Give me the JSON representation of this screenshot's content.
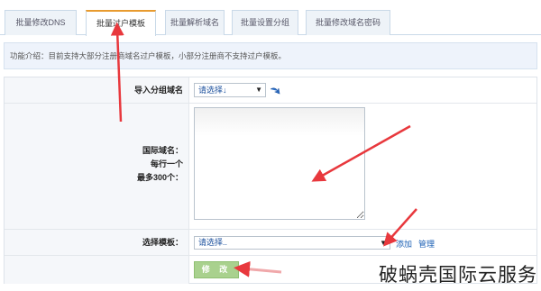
{
  "tabs": [
    {
      "label": "批量修改DNS",
      "active": false
    },
    {
      "label": "批量过户模板",
      "active": true
    },
    {
      "label": "批量解析域名",
      "active": false
    },
    {
      "label": "批量设置分组",
      "active": false
    },
    {
      "label": "批量修改域名密码",
      "active": false
    }
  ],
  "intro": {
    "text": "功能介绍：目前支持大部分注册商域名过户模板，小部分注册商不支持过户模板。"
  },
  "form": {
    "import_group": {
      "label": "导入分组域名",
      "select_value": "请选择↓"
    },
    "domains": {
      "label_line1": "国际域名：",
      "label_line2": "每行一个",
      "label_line3": "最多300个："
    },
    "template": {
      "label": "选择模板：",
      "select_value": "请选择..",
      "add_link": "添加",
      "manage_link": "管理"
    },
    "submit_label": "修 改"
  },
  "watermark": "破蜗壳国际云服务",
  "colors": {
    "accent": "#e89b2f",
    "arrow": "#e8383d",
    "button": "#a9d18e",
    "link": "#1a5fb4"
  }
}
